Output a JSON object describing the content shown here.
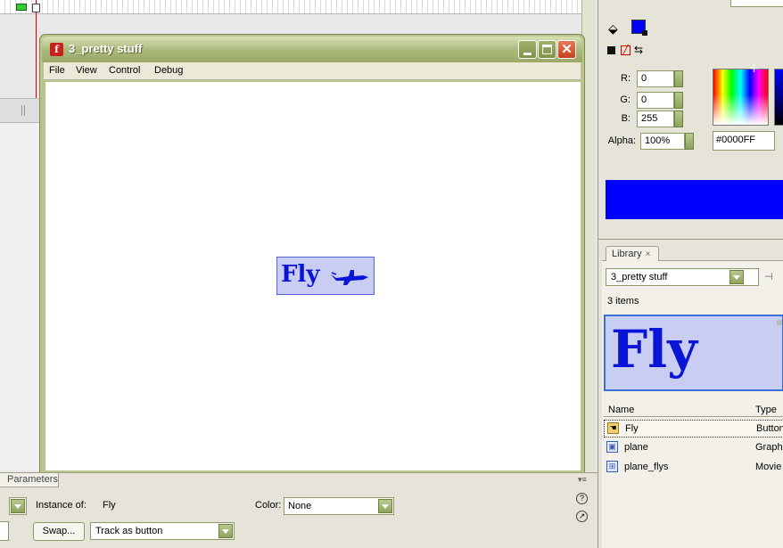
{
  "player": {
    "title": "3_pretty stuff",
    "menu": [
      "File",
      "View",
      "Control",
      "Debug"
    ],
    "close_glyph": "✕"
  },
  "stage": {
    "fly_button_label": "Fly"
  },
  "properties": {
    "tab_label": "Parameters",
    "instance_of_label": "Instance of:",
    "instance_of_value": "Fly",
    "color_label": "Color:",
    "color_value": "None",
    "swap_label": "Swap...",
    "track_value": "Track as button",
    "help_glyph": "?",
    "nav_glyph": "↗",
    "options_glyph": "▾≡"
  },
  "color_mixer": {
    "r_label": "R:",
    "r_value": "0",
    "g_label": "G:",
    "g_value": "0",
    "b_label": "B:",
    "b_value": "255",
    "alpha_label": "Alpha:",
    "alpha_value": "100%",
    "hex_value": "#0000FF",
    "fill_color": "#0000FF",
    "stroke_glyph": "⬚",
    "none_glyph": "╱",
    "swap_glyph": "⇆"
  },
  "library": {
    "tab_label": "Library",
    "tab_close": "×",
    "document": "3_pretty stuff",
    "pin_glyph": "⊣",
    "item_count": "3 items",
    "preview_text": "Fly",
    "col_name": "Name",
    "col_type": "Type",
    "items": [
      {
        "name": "Fly",
        "type": "Button",
        "icon": "button-symbol-icon",
        "glyph": "☚"
      },
      {
        "name": "plane",
        "type": "Graphic",
        "icon": "graphic-symbol-icon",
        "glyph": "▣"
      },
      {
        "name": "plane_flys",
        "type": "Movie Clip",
        "icon": "movieclip-symbol-icon",
        "glyph": "⊞"
      }
    ]
  }
}
